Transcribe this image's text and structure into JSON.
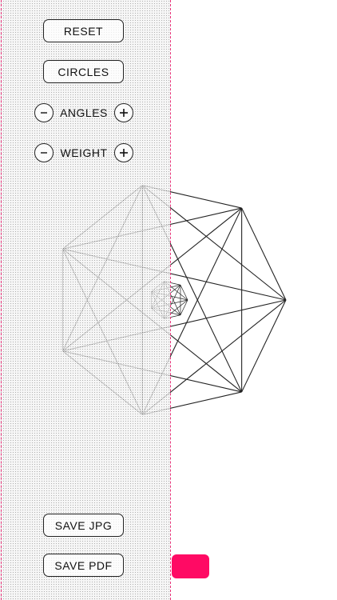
{
  "controls": {
    "reset_label": "RESET",
    "circles_label": "CIRCLES",
    "angles_label": "ANGLES",
    "weight_label": "WEIGHT",
    "save_jpg_label": "SAVE JPG",
    "save_pdf_label": "SAVE PDF"
  },
  "colors": {
    "accent": "#ff0a64",
    "line": "#222222",
    "guide": "#e8347a"
  },
  "figure": {
    "shape": "heptagon with all diagonals",
    "vertices": 7
  }
}
